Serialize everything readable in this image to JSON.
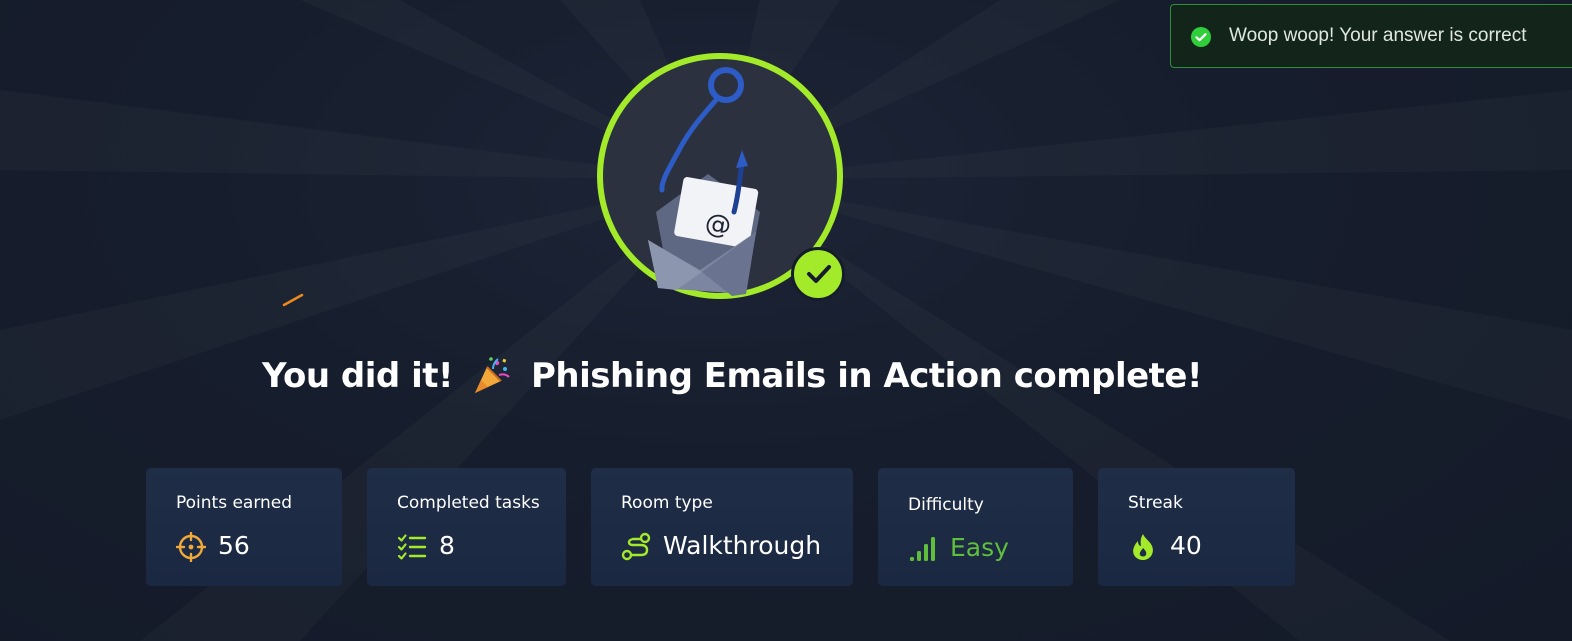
{
  "toast": {
    "message": "Woop woop! Your answer is correct",
    "status": "success",
    "status_color": "#2fce3a"
  },
  "badge": {
    "icon": "phishing-email-hook-icon",
    "ring_color": "#a3ea2a",
    "completed_icon": "check-icon"
  },
  "headline": {
    "prefix": "You did it!",
    "emoji_icon": "party-popper-icon",
    "suffix": "Phishing Emails in Action complete!"
  },
  "stats": {
    "points": {
      "label": "Points earned",
      "value": "56",
      "icon": "crosshair-icon",
      "icon_color": "#f0a93b"
    },
    "tasks": {
      "label": "Completed tasks",
      "value": "8",
      "icon": "checklist-icon",
      "icon_color": "#a3ea2a"
    },
    "room_type": {
      "label": "Room type",
      "value": "Walkthrough",
      "icon": "route-icon",
      "icon_color": "#a3ea2a"
    },
    "difficulty": {
      "label": "Difficulty",
      "value": "Easy",
      "icon": "signal-bars-icon",
      "icon_color": "#5fbf3c"
    },
    "streak": {
      "label": "Streak",
      "value": "40",
      "icon": "flame-icon",
      "icon_color": "#a3ea2a"
    }
  }
}
